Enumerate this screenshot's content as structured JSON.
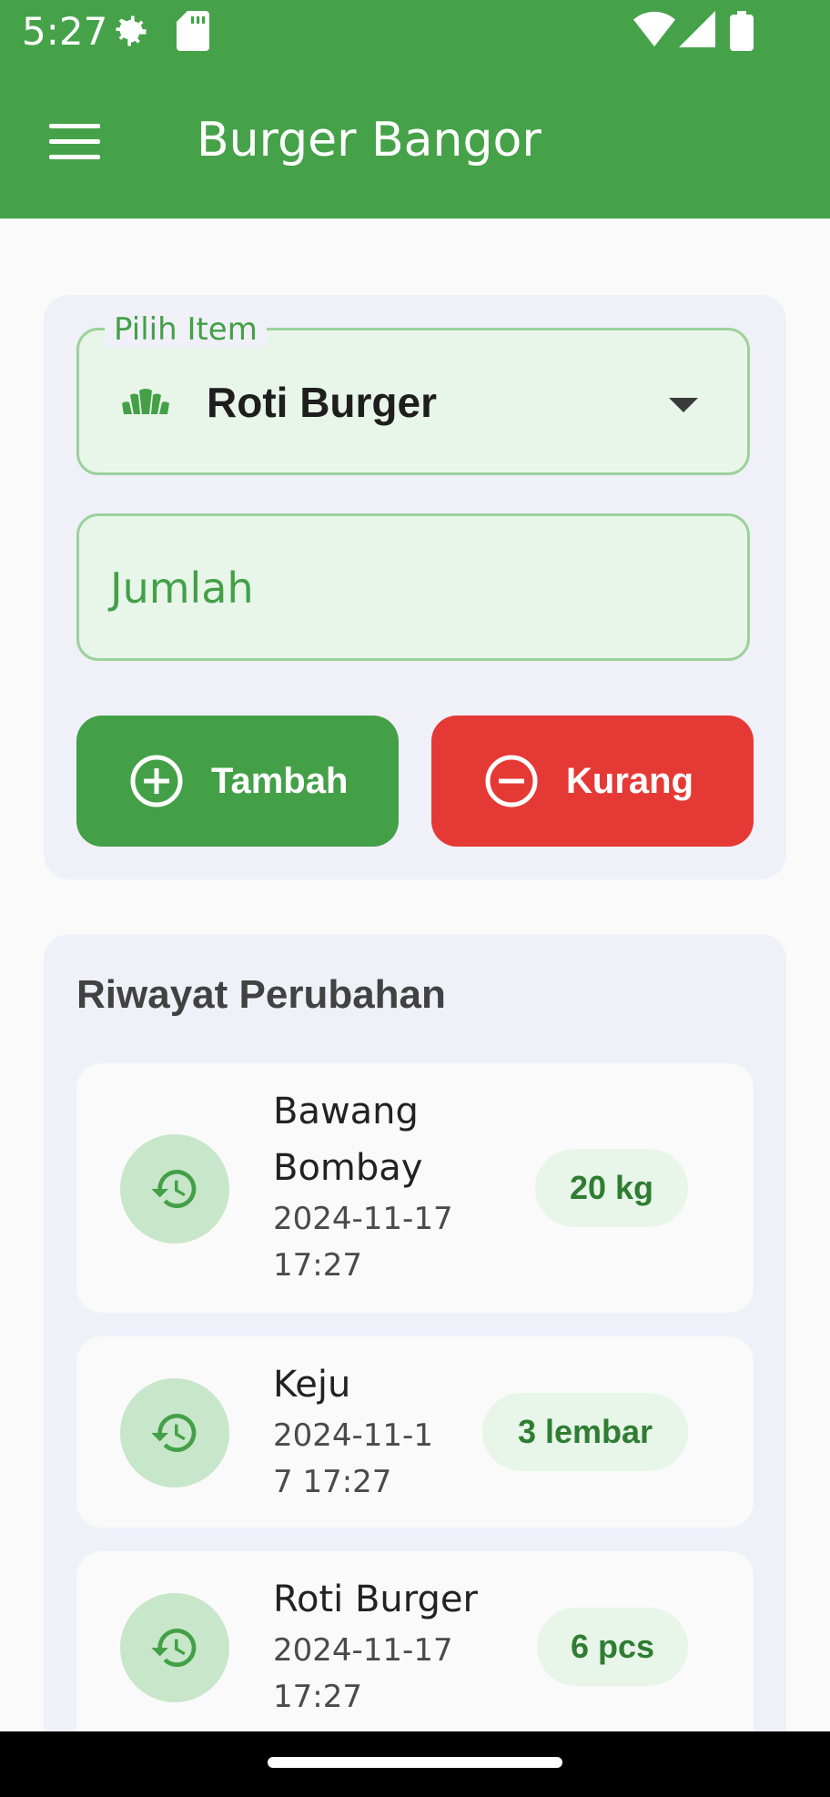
{
  "status_bar": {
    "time": "5:27",
    "icons": [
      "settings-icon",
      "sd-card-icon",
      "wifi-icon",
      "signal-icon",
      "battery-icon"
    ]
  },
  "app_bar": {
    "title": "Burger Bangor",
    "menu_icon": "menu-icon"
  },
  "form": {
    "item_select": {
      "label": "Pilih Item",
      "value": "Roti Burger",
      "icon": "bakery-icon"
    },
    "quantity_input": {
      "placeholder": "Jumlah",
      "value": ""
    },
    "add_button": {
      "label": "Tambah",
      "icon": "add-circle-icon"
    },
    "subtract_button": {
      "label": "Kurang",
      "icon": "remove-circle-icon"
    }
  },
  "history": {
    "title": "Riwayat Perubahan",
    "items": [
      {
        "name_line1": "Bawang",
        "name_line2": "Bombay",
        "date_line1": "2024-11-17",
        "date_line2": "17:27",
        "badge": "20 kg",
        "icon": "history-icon"
      },
      {
        "name_line1": "Keju",
        "date_line1": "2024-11-1",
        "date_line2": "7 17:27",
        "badge": "3 lembar",
        "icon": "history-icon"
      },
      {
        "name_line1": "Roti Burger",
        "date_line1": "2024-11-17",
        "date_line2": "17:27",
        "badge": "6 pcs",
        "icon": "history-icon"
      }
    ]
  },
  "colors": {
    "primary": "#46a249",
    "danger": "#e53935",
    "field_bg": "#e8f5e9",
    "card_bg": "#f0f0f9"
  }
}
